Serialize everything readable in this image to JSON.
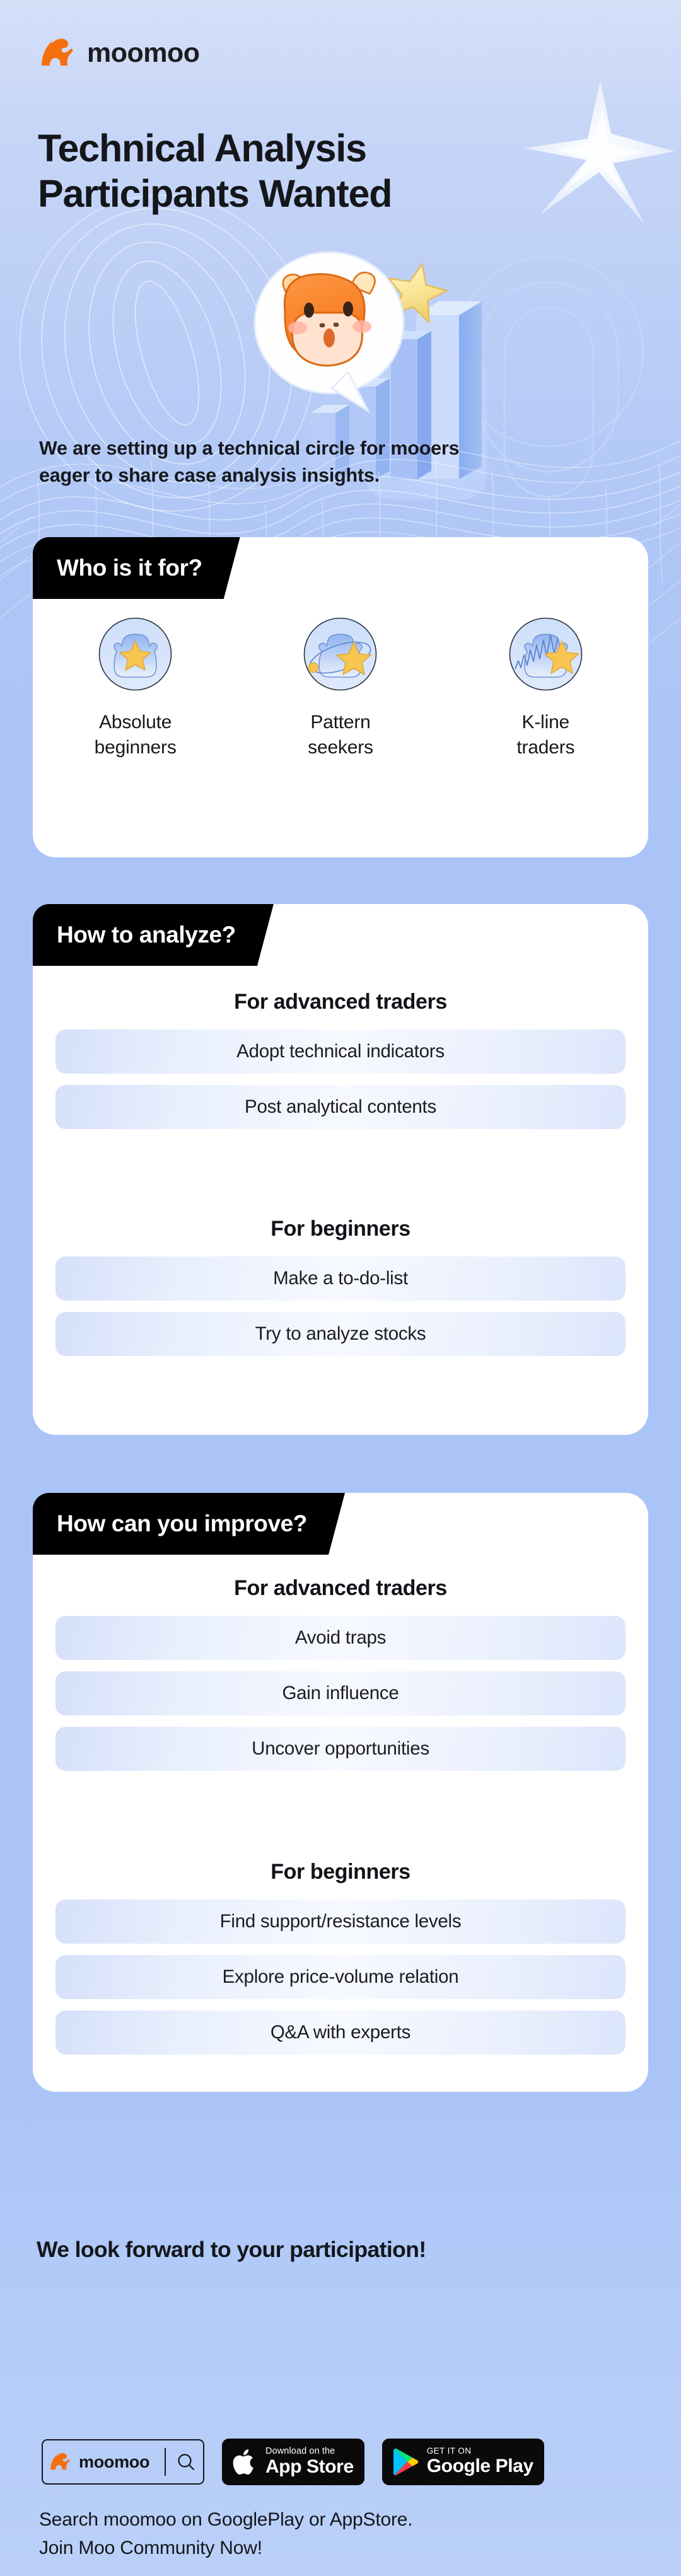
{
  "brand": {
    "name": "moomoo",
    "logo_icon": "moomoo-bull-logo"
  },
  "hero": {
    "title_line1": "Technical Analysis",
    "title_line2": "Participants Wanted",
    "subtitle_line1": "We are setting up a technical circle for mooers",
    "subtitle_line2": "eager to share case analysis insights.",
    "sparkle_icon": "sparkle-star-icon",
    "illustration_icon": "bull-mascot-bar-chart-illustration"
  },
  "sections": [
    {
      "tab_label": "Who is it for?",
      "personas": [
        {
          "label_line1": "Absolute",
          "label_line2": "beginners",
          "avatar_icon": "bull-star-avatar-icon"
        },
        {
          "label_line1": "Pattern",
          "label_line2": "seekers",
          "avatar_icon": "bull-orbit-star-avatar-icon"
        },
        {
          "label_line1": "K-line",
          "label_line2": "traders",
          "avatar_icon": "bull-kline-star-avatar-icon"
        }
      ]
    },
    {
      "tab_label": "How to analyze?",
      "groups": [
        {
          "heading": "For advanced traders",
          "items": [
            "Adopt technical indicators",
            "Post analytical contents"
          ]
        },
        {
          "heading": "For beginners",
          "items": [
            "Make a to-do-list",
            "Try to analyze stocks"
          ]
        }
      ]
    },
    {
      "tab_label": "How can you improve?",
      "groups": [
        {
          "heading": "For advanced traders",
          "items": [
            "Avoid traps",
            "Gain influence",
            "Uncover opportunities"
          ]
        },
        {
          "heading": "For beginners",
          "items": [
            "Find support/resistance levels",
            "Explore price-volume relation",
            "Q&A with experts"
          ]
        }
      ]
    }
  ],
  "closing": "We look forward to your participation!",
  "footer": {
    "badges": [
      {
        "type": "moomoo-search",
        "name": "moomoo",
        "search_icon": "search-icon",
        "logo_icon": "moomoo-bull-logo"
      },
      {
        "type": "app-store",
        "small": "Download on the",
        "big": "App Store",
        "icon": "apple-logo-icon"
      },
      {
        "type": "google-play",
        "small": "GET IT ON",
        "big": "Google Play",
        "icon": "google-play-icon"
      }
    ],
    "text_line1": "Search moomoo on GooglePlay or AppStore.",
    "text_line2": "Join Moo Community Now!"
  },
  "colors": {
    "background_top": "#d5dff8",
    "background_main": "#aac4f7",
    "card": "#ffffff",
    "tab": "#000000",
    "brand_orange": "#f5700c",
    "star_gold": "#f7c94a",
    "text_dark": "#15161a"
  }
}
